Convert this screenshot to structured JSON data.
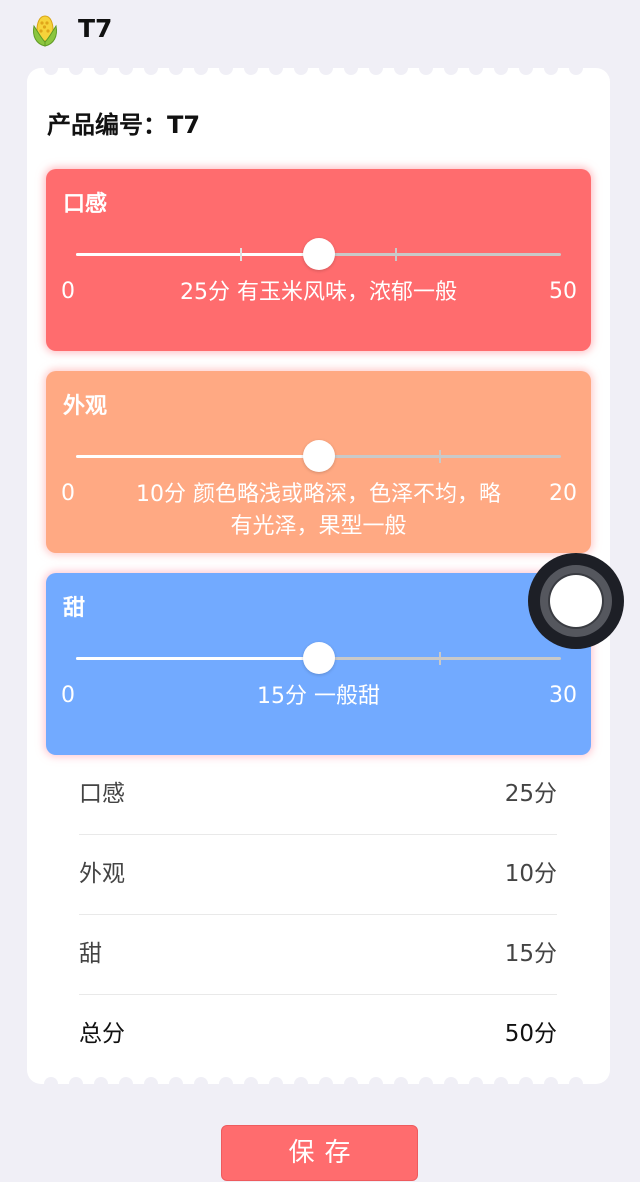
{
  "header": {
    "title": "T7",
    "logo_icon": "corn-icon"
  },
  "product": {
    "label": "产品编号：T7"
  },
  "cards": [
    {
      "title": "口感",
      "min": "0",
      "max": "50",
      "value": 25,
      "max_value": 50,
      "marks": [
        17,
        33
      ],
      "description": "25分 有玉米风味，浓郁一般",
      "color": "#ff6c6e"
    },
    {
      "title": "外观",
      "min": "0",
      "max": "20",
      "value": 10,
      "max_value": 20,
      "marks": [
        15
      ],
      "description": "10分 颜色略浅或略深，色泽不均，略有光泽，果型一般",
      "color": "#ffa983"
    },
    {
      "title": "甜",
      "min": "0",
      "max": "30",
      "value": 15,
      "max_value": 30,
      "marks": [
        22.5
      ],
      "description": "15分 一般甜",
      "color": "#72aaff"
    }
  ],
  "summary": {
    "rows": [
      {
        "label": "口感",
        "value": "25分"
      },
      {
        "label": "外观",
        "value": "10分"
      },
      {
        "label": "甜",
        "value": "15分"
      },
      {
        "label": "总分",
        "value": "50分"
      }
    ]
  },
  "actions": {
    "save_label": "保存"
  }
}
